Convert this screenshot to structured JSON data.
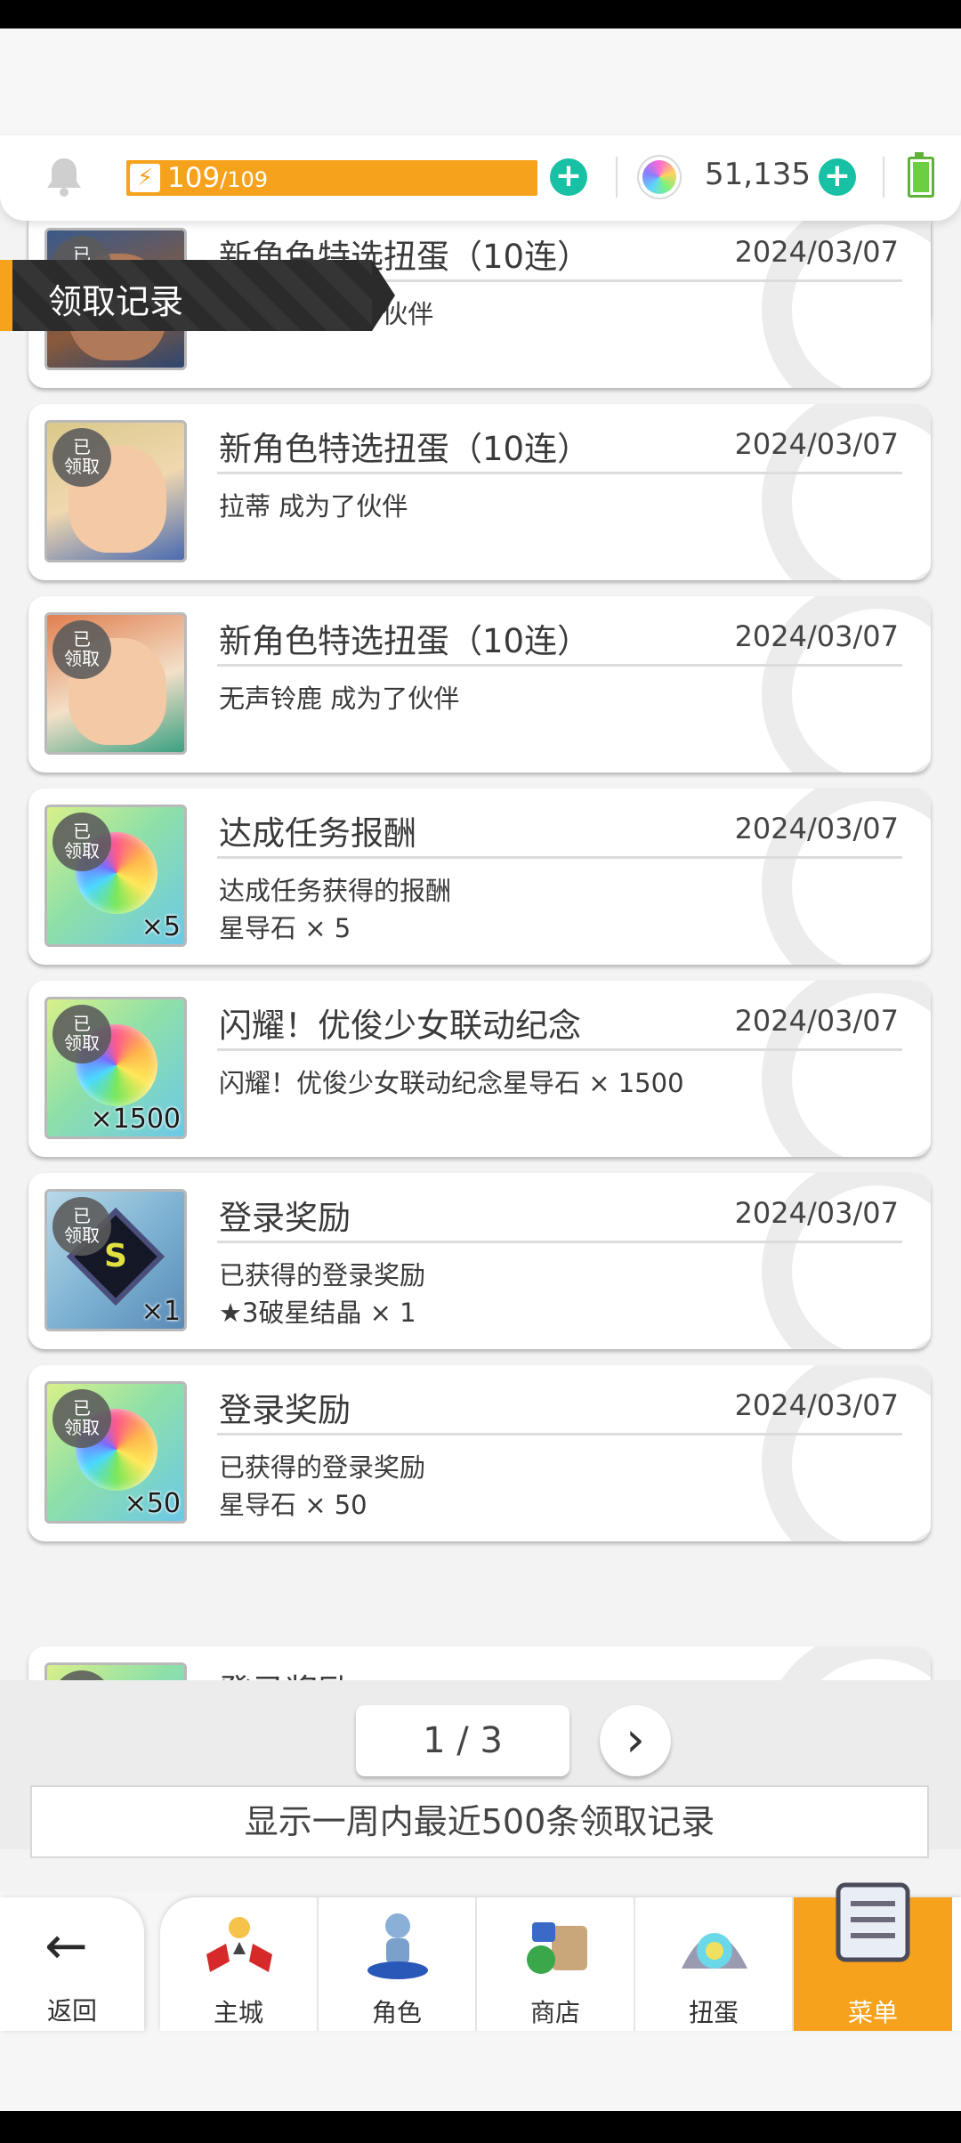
{
  "header": {
    "stamina_current": "109",
    "stamina_max": "/109",
    "gem_count": "51,135",
    "accent": "#f7a21c",
    "plus_color": "#18c0a4"
  },
  "section_title": "领取记录",
  "claimed_badge": [
    "已",
    "领取"
  ],
  "records": [
    {
      "title": "",
      "date": "",
      "desc": [
        "",
        ""
      ]
    },
    {
      "title": "新角色特选扭蛋（10连）",
      "date": "2024/03/07",
      "desc": [
        "瓦尔塔 成为了伙伴",
        ""
      ],
      "qty": "",
      "thumb": "character"
    },
    {
      "title": "新角色特选扭蛋（10连）",
      "date": "2024/03/07",
      "desc": [
        "拉蒂 成为了伙伴",
        ""
      ],
      "qty": "",
      "thumb": "character"
    },
    {
      "title": "新角色特选扭蛋（10连）",
      "date": "2024/03/07",
      "desc": [
        "无声铃鹿 成为了伙伴",
        ""
      ],
      "qty": "",
      "thumb": "character"
    },
    {
      "title": "达成任务报酬",
      "date": "2024/03/07",
      "desc": [
        "达成任务获得的报酬",
        "星导石 × 5"
      ],
      "qty": "×5",
      "thumb": "star-stone"
    },
    {
      "title": "闪耀！优俊少女联动纪念",
      "date": "2024/03/07",
      "desc": [
        "闪耀！优俊少女联动纪念星导石 × 1500",
        ""
      ],
      "qty": "×1500",
      "thumb": "star-stone"
    },
    {
      "title": "登录奖励",
      "date": "2024/03/07",
      "desc": [
        "已获得的登录奖励",
        "★3破星结晶 × 1"
      ],
      "qty": "×1",
      "thumb": "crystal"
    },
    {
      "title": "登录奖励",
      "date": "2024/03/07",
      "desc": [
        "已获得的登录奖励",
        "星导石 × 50"
      ],
      "qty": "×50",
      "thumb": "star-stone"
    },
    {
      "title": "登录奖励",
      "date": "",
      "desc": [
        "",
        ""
      ],
      "qty": "",
      "thumb": "star-stone"
    }
  ],
  "pager": {
    "label": "1 / 3",
    "next_icon": "chevron-right-icon"
  },
  "info_text": "显示一周内最近500条领取记录",
  "nav": {
    "back": "返回",
    "tabs": [
      "主城",
      "角色",
      "商店",
      "扭蛋",
      "菜单"
    ]
  }
}
